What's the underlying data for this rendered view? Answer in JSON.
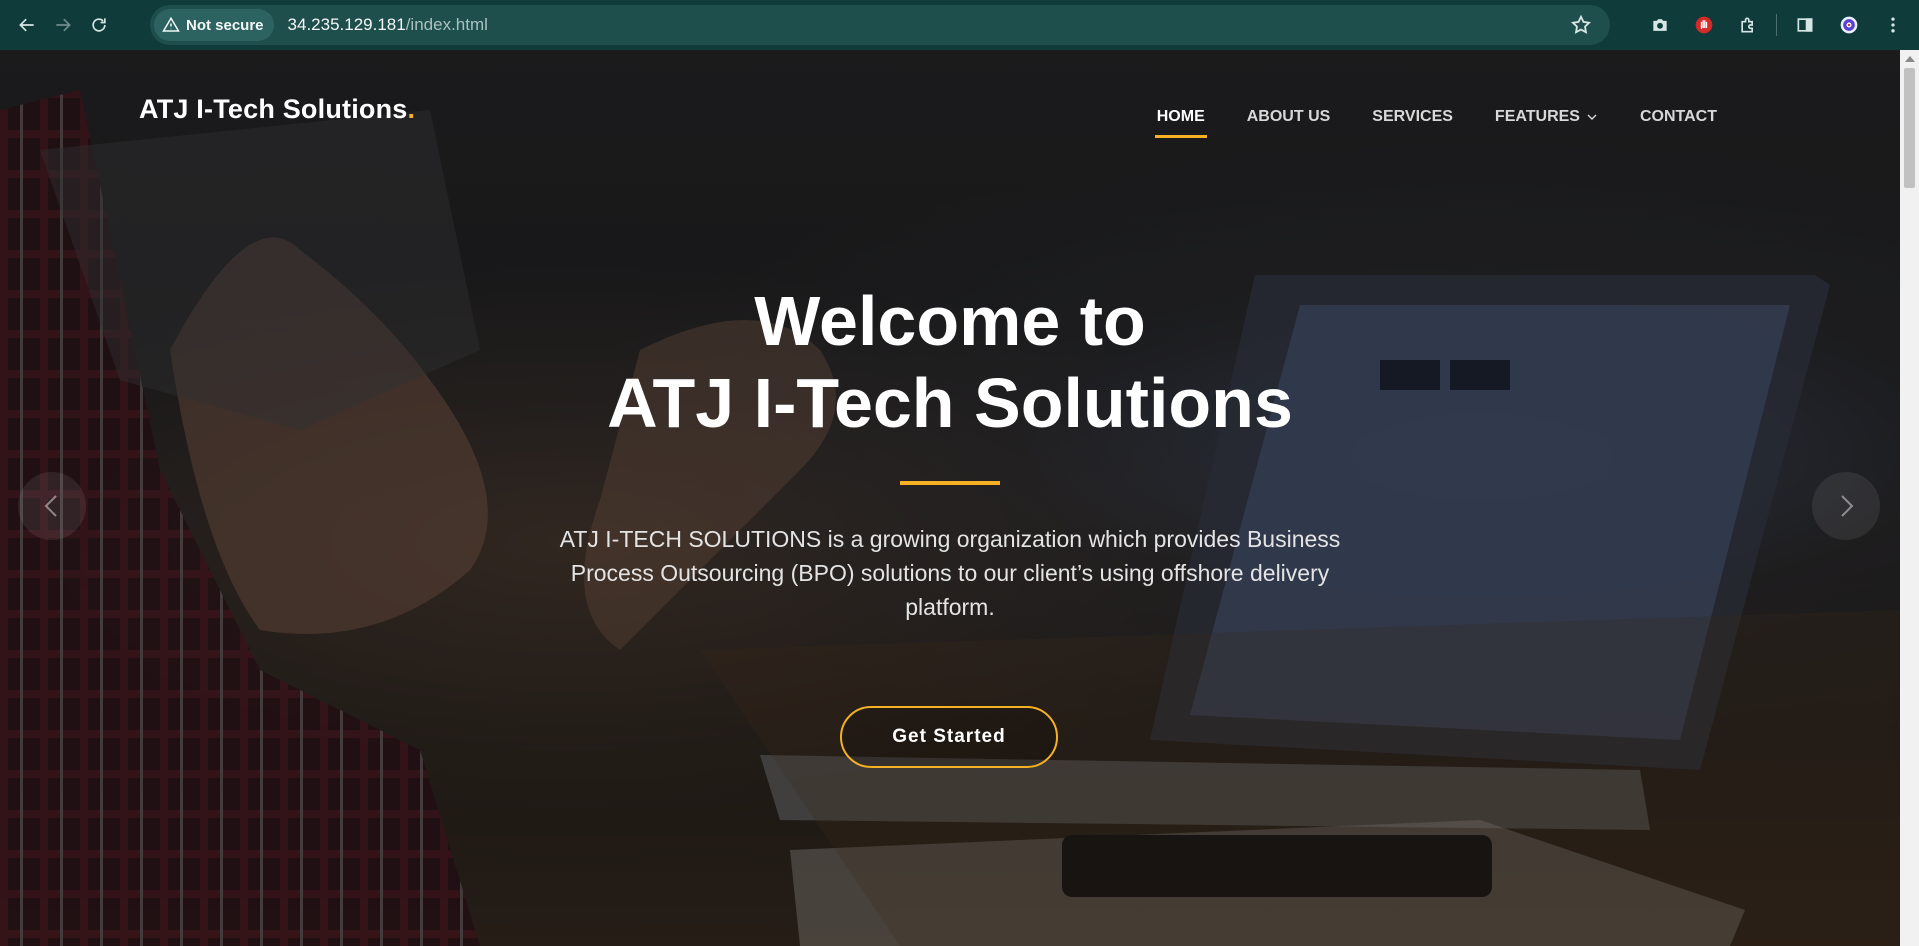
{
  "browser": {
    "security_label": "Not secure",
    "url_host": "34.235.129.181",
    "url_path": "/index.html"
  },
  "site": {
    "logo_text": "ATJ I-Tech Solutions",
    "logo_dot": ".",
    "nav": [
      {
        "label": "HOME",
        "active": true
      },
      {
        "label": "ABOUT US"
      },
      {
        "label": "SERVICES"
      },
      {
        "label": "FEATURES",
        "dropdown": true
      },
      {
        "label": "CONTACT"
      }
    ]
  },
  "hero": {
    "title_line1": "Welcome to",
    "title_line2": "ATJ I-Tech Solutions",
    "description": "ATJ I-TECH SOLUTIONS is a growing organization which provides Business Process Outsourcing (BPO) solutions to our client’s using offshore delivery platform.",
    "cta_label": "Get Started"
  },
  "colors": {
    "accent": "#f6b024",
    "chrome_bg": "#0f3b3a"
  }
}
